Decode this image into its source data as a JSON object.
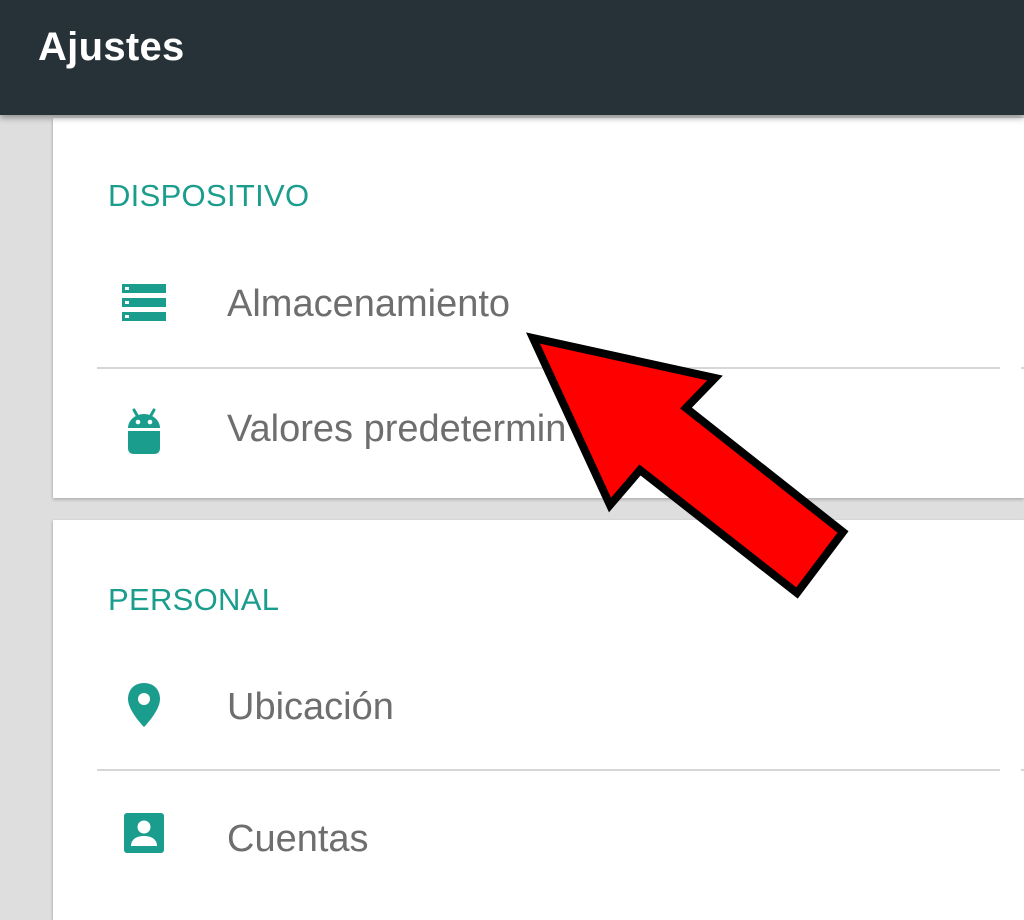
{
  "appbar": {
    "title": "Ajustes",
    "background": "#263238"
  },
  "accent_color": "#1b9d8d",
  "sections": [
    {
      "header": "DISPOSITIVO",
      "items": [
        {
          "label": "Almacenamiento",
          "icon": "storage-icon"
        },
        {
          "label": "Valores predetermin",
          "icon": "android-icon"
        }
      ]
    },
    {
      "header": "PERSONAL",
      "items": [
        {
          "label": "Ubicación",
          "icon": "location-pin-icon"
        },
        {
          "label": "Cuentas",
          "icon": "account-icon"
        }
      ]
    }
  ],
  "annotation": {
    "type": "arrow",
    "color": "#ff0000",
    "points_to": "Almacenamiento"
  }
}
